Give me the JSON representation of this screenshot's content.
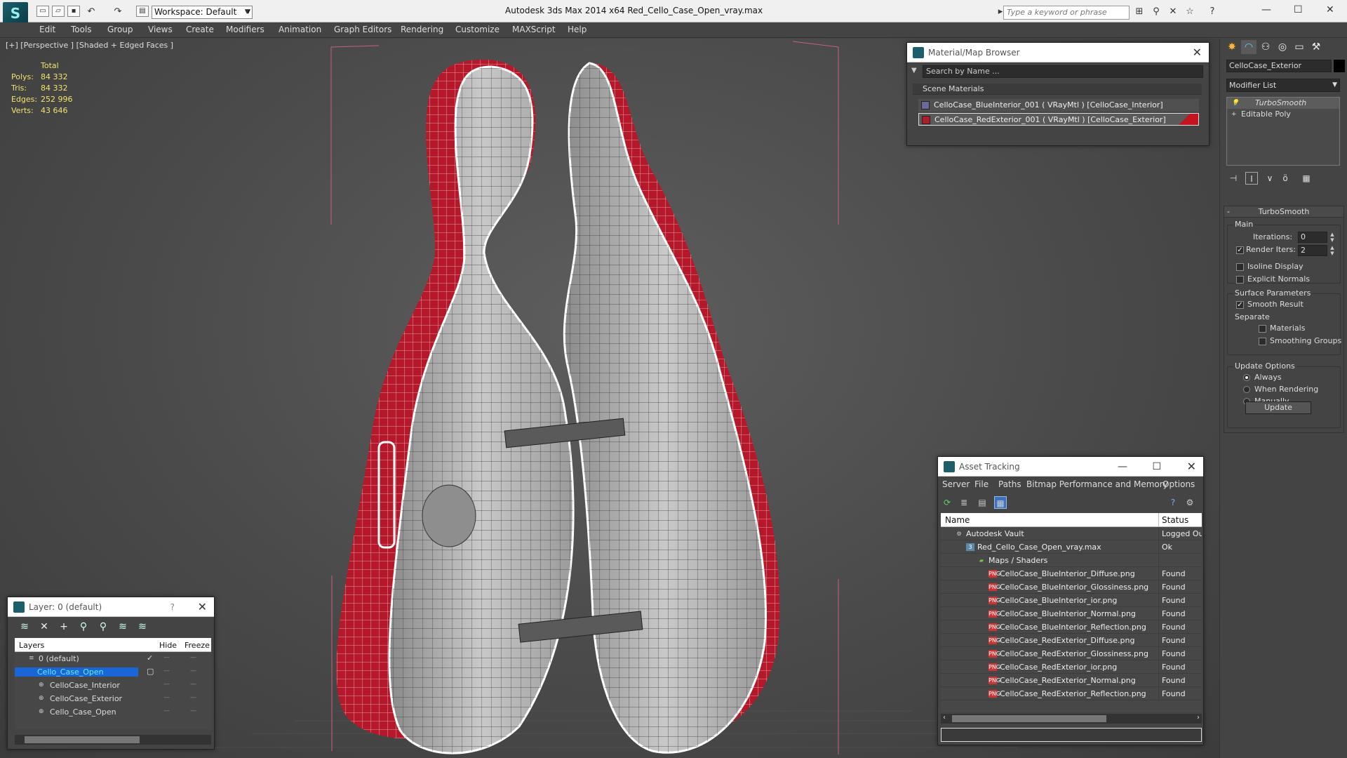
{
  "titlebar": {
    "workspace": "Workspace: Default",
    "app_title": "Autodesk 3ds Max  2014 x64      Red_Cello_Case_Open_vray.max",
    "search_placeholder": "Type a keyword or phrase"
  },
  "menubar": [
    "Edit",
    "Tools",
    "Group",
    "Views",
    "Create",
    "Modifiers",
    "Animation",
    "Graph Editors",
    "Rendering",
    "Customize",
    "MAXScript",
    "Help"
  ],
  "viewport": {
    "label": "[+] [Perspective ] [Shaded + Edged Faces ]",
    "stats": {
      "header": "Total",
      "polys_label": "Polys:",
      "polys": "84 332",
      "tris_label": "Tris:",
      "tris": "84 332",
      "edges_label": "Edges:",
      "edges": "252 996",
      "verts_label": "Verts:",
      "verts": "43 646"
    }
  },
  "material_browser": {
    "title": "Material/Map Browser",
    "search": "Search by Name ...",
    "section": "Scene Materials",
    "items": [
      "CelloCase_BlueInterior_001  ( VRayMtl ) [CelloCase_Interior]",
      "CelloCase_RedExterior_001  ( VRayMtl ) [CelloCase_Exterior]"
    ]
  },
  "command_panel": {
    "object_name": "CelloCase_Exterior",
    "modifier_list": "Modifier List",
    "stack": [
      "TurboSmooth",
      "Editable Poly"
    ],
    "rollout_title": "TurboSmooth",
    "main_group": "Main",
    "iterations_label": "Iterations:",
    "iterations": "0",
    "render_iters_label": "Render Iters:",
    "render_iters": "2",
    "isoline": "Isoline Display",
    "explicit_normals": "Explicit Normals",
    "surface_group": "Surface Parameters",
    "smooth_result": "Smooth Result",
    "separate": "Separate",
    "materials": "Materials",
    "smoothing_groups": "Smoothing Groups",
    "update_group": "Update Options",
    "always": "Always",
    "when_rendering": "When Rendering",
    "manually": "Manually",
    "update_button": "Update"
  },
  "asset_tracking": {
    "title": "Asset Tracking",
    "menu": [
      "Server",
      "File",
      "Paths",
      "Bitmap Performance and Memory",
      "Options"
    ],
    "col_name": "Name",
    "col_status": "Status",
    "rows": [
      {
        "name": "Autodesk Vault",
        "status": "Logged Out"
      },
      {
        "name": "Red_Cello_Case_Open_vray.max",
        "status": "Ok"
      },
      {
        "name": "Maps / Shaders",
        "status": ""
      },
      {
        "name": "CelloCase_BlueInterior_Diffuse.png",
        "status": "Found"
      },
      {
        "name": "CelloCase_BlueInterior_Glossiness.png",
        "status": "Found"
      },
      {
        "name": "CelloCase_BlueInterior_ior.png",
        "status": "Found"
      },
      {
        "name": "CelloCase_BlueInterior_Normal.png",
        "status": "Found"
      },
      {
        "name": "CelloCase_BlueInterior_Reflection.png",
        "status": "Found"
      },
      {
        "name": "CelloCase_RedExterior_Diffuse.png",
        "status": "Found"
      },
      {
        "name": "CelloCase_RedExterior_Glossiness.png",
        "status": "Found"
      },
      {
        "name": "CelloCase_RedExterior_ior.png",
        "status": "Found"
      },
      {
        "name": "CelloCase_RedExterior_Normal.png",
        "status": "Found"
      },
      {
        "name": "CelloCase_RedExterior_Reflection.png",
        "status": "Found"
      }
    ]
  },
  "layers": {
    "title": "Layer: 0 (default)",
    "col_layers": "Layers",
    "col_hide": "Hide",
    "col_freeze": "Freeze",
    "rows": [
      "0 (default)",
      "Cello_Case_Open",
      "CelloCase_Interior",
      "CelloCase_Exterior",
      "Cello_Case_Open"
    ]
  },
  "colors": {
    "case_red": "#b5182a",
    "case_interior": "#bdbdbd",
    "stats_yellow": "#f2e46a",
    "selection_blue": "#1a66d6"
  }
}
